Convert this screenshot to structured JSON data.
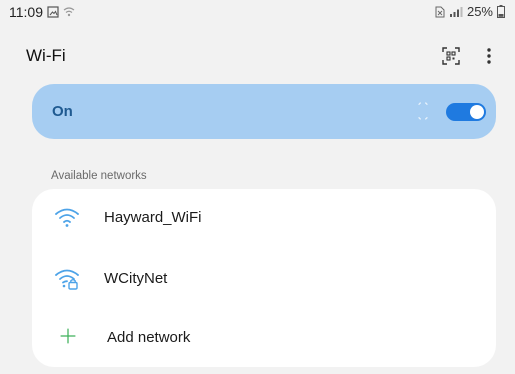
{
  "status_bar": {
    "time": "11:09",
    "battery": "25%"
  },
  "header": {
    "title": "Wi-Fi",
    "actions": [
      "qr-scan-icon",
      "more-options-icon"
    ]
  },
  "master_switch": {
    "label": "On",
    "state": "on",
    "accent_color": "#1f7ae0",
    "card_color": "#a6cdf2"
  },
  "available_networks": {
    "header": "Available networks",
    "items": [
      {
        "label": "Hayward_WiFi",
        "icon": "wifi-signal-icon",
        "secured": false
      },
      {
        "label": "WCityNet",
        "icon": "wifi-locked-icon",
        "secured": true
      },
      {
        "label": "Add network",
        "icon": "plus-icon"
      }
    ]
  }
}
